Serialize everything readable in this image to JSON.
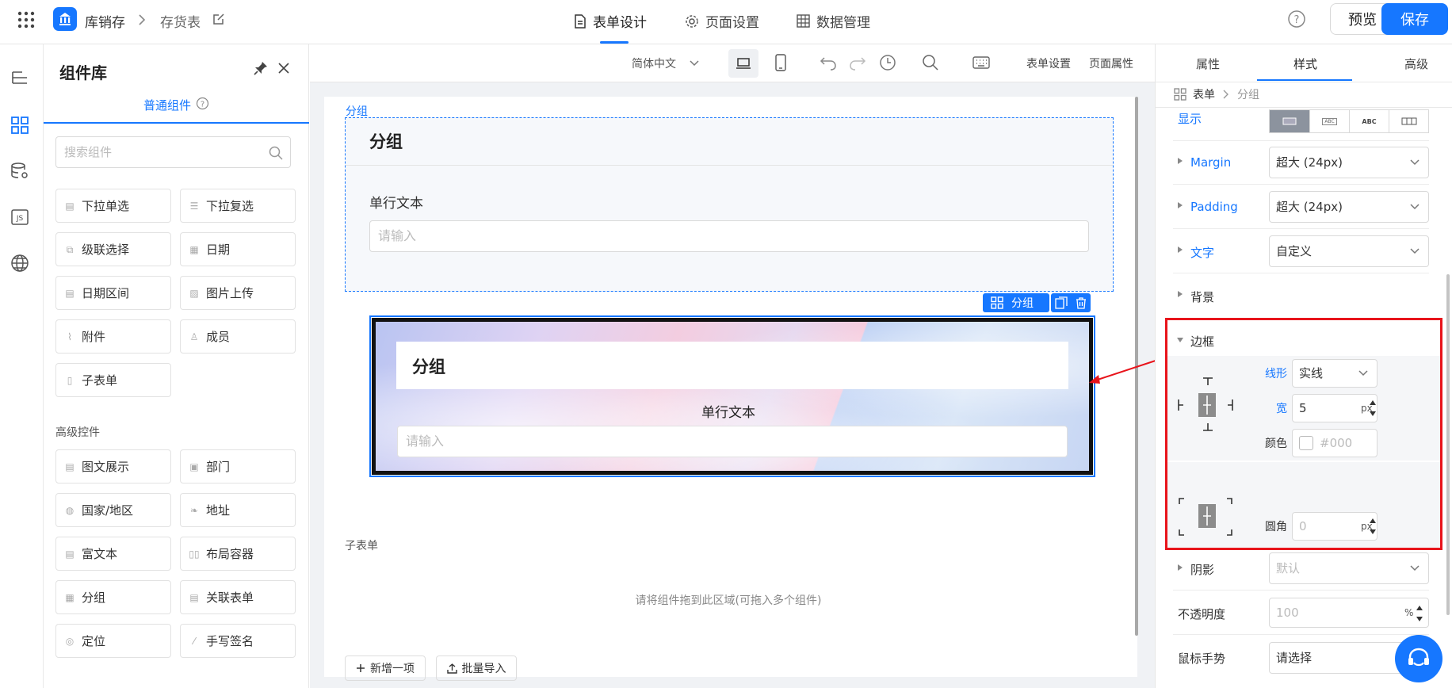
{
  "topbar": {
    "app_name": "库销存",
    "page_name": "存货表",
    "tabs": [
      "表单设计",
      "页面设置",
      "数据管理"
    ],
    "preview": "预览",
    "save": "保存"
  },
  "library": {
    "title": "组件库",
    "tab": "普通组件",
    "search_placeholder": "搜索组件",
    "basic": [
      "下拉单选",
      "下拉复选",
      "级联选择",
      "日期",
      "日期区间",
      "图片上传",
      "附件",
      "成员",
      "子表单"
    ],
    "advanced_title": "高级控件",
    "advanced": [
      "图文展示",
      "部门",
      "国家/地区",
      "地址",
      "富文本",
      "布局容器",
      "分组",
      "关联表单",
      "定位",
      "手写签名"
    ]
  },
  "toolbar": {
    "lang": "简体中文",
    "form_settings": "表单设置",
    "page_props": "页面属性"
  },
  "form": {
    "group_tag": "分组",
    "group1_title": "分组",
    "field_label": "单行文本",
    "input_placeholder": "请输入",
    "badge": "分组",
    "group2_title": "分组",
    "field2_label": "单行文本",
    "input2_placeholder": "请输入",
    "subform_label": "子表单",
    "drop_hint": "请将组件拖到此区域(可拖入多个组件)",
    "add_item": "新增一项",
    "batch_import": "批量导入"
  },
  "panel": {
    "tabs": [
      "属性",
      "样式",
      "高级"
    ],
    "crumb_root": "表单",
    "crumb_current": "分组",
    "display_label": "显示",
    "display_opt_abc_small": "ABC",
    "display_opt_abc": "ABC",
    "margin_label": "Margin",
    "margin_value": "超大 (24px)",
    "padding_label": "Padding",
    "padding_value": "超大 (24px)",
    "text_label": "文字",
    "text_value": "自定义",
    "bg_label": "背景",
    "border_label": "边框",
    "line_label": "线形",
    "line_value": "实线",
    "width_label": "宽",
    "width_value": "5",
    "unit": "px",
    "color_label": "颜色",
    "color_placeholder": "#000",
    "radius_label": "圆角",
    "radius_placeholder": "0",
    "shadow_label": "阴影",
    "shadow_value": "默认",
    "opacity_label": "不透明度",
    "opacity_value": "100",
    "opacity_unit": "%",
    "cursor_label": "鼠标手势",
    "cursor_value": "请选择"
  },
  "colors": {
    "accent": "#1677ff",
    "highlight": "#e8141b"
  }
}
